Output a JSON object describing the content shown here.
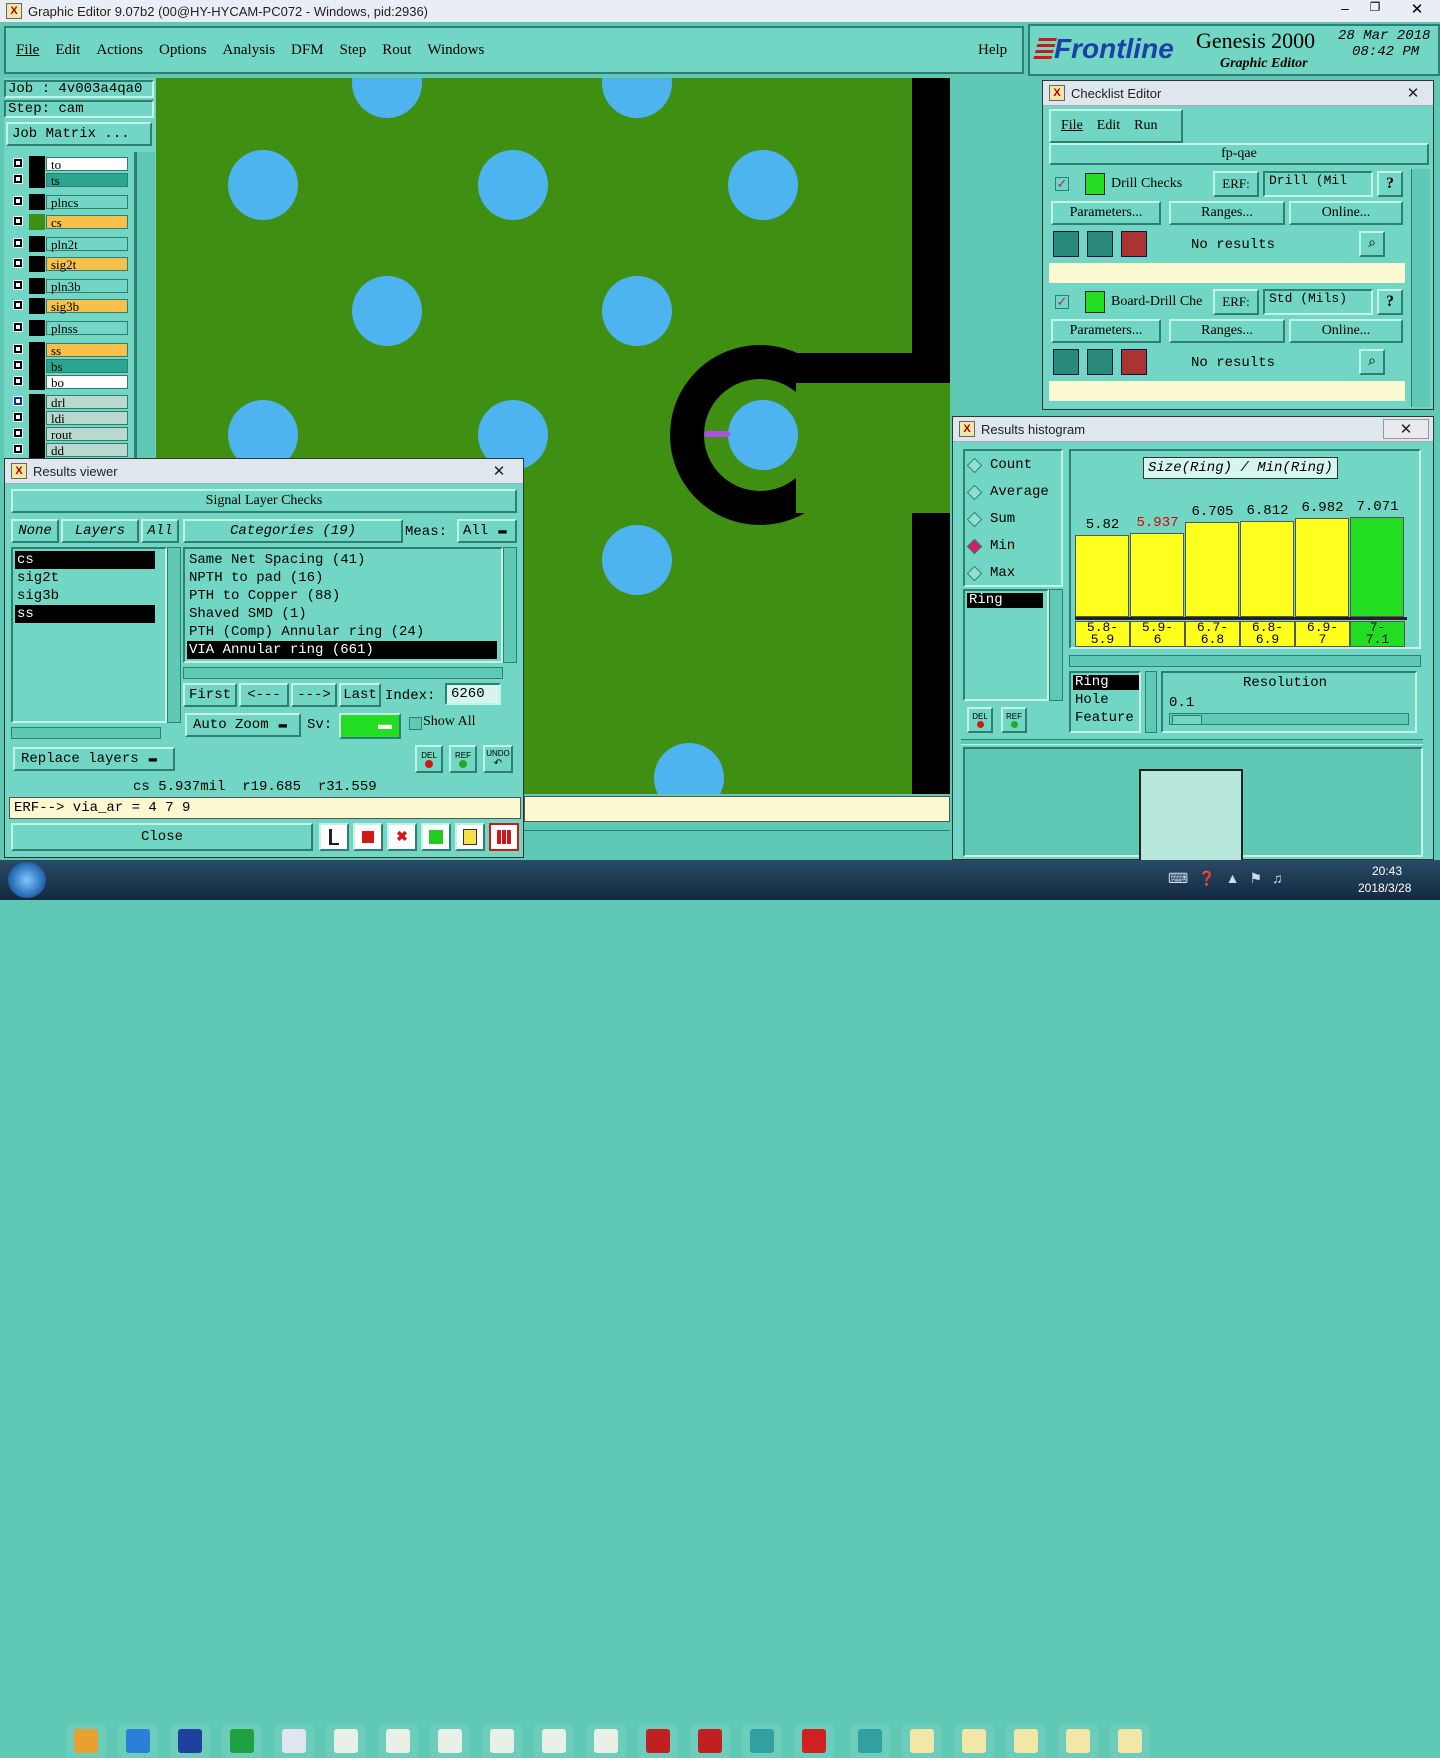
{
  "window": {
    "title": "Graphic Editor 9.07b2 (00@HY-HYCAM-PC072 - Windows, pid:2936)"
  },
  "menu": [
    "File",
    "Edit",
    "Actions",
    "Options",
    "Analysis",
    "DFM",
    "Step",
    "Rout",
    "Windows"
  ],
  "help_label": "Help",
  "brand": {
    "logo": "Frontline",
    "product": "Genesis 2000",
    "subtitle": "Graphic Editor",
    "date": "28 Mar 2018",
    "time": "08:42 PM"
  },
  "job": {
    "job_label": "Job : 4v003a4qa0",
    "step_label": "Step: cam",
    "matrix_button": "Job Matrix ..."
  },
  "layers": [
    {
      "name": "to",
      "color": "#ffffff"
    },
    {
      "name": "ts",
      "color": "#2aa58f"
    },
    {
      "name": "plncs",
      "color": "#71d6c3"
    },
    {
      "name": "cs",
      "color": "#f7c04a"
    },
    {
      "name": "pln2t",
      "color": "#71d6c3"
    },
    {
      "name": "sig2t",
      "color": "#f7c04a"
    },
    {
      "name": "pln3b",
      "color": "#71d6c3"
    },
    {
      "name": "sig3b",
      "color": "#f7c04a"
    },
    {
      "name": "plnss",
      "color": "#71d6c3"
    },
    {
      "name": "ss",
      "color": "#f7c04a"
    },
    {
      "name": "bs",
      "color": "#2aa58f"
    },
    {
      "name": "bo",
      "color": "#ffffff"
    },
    {
      "name": "drl",
      "color": "#b8d8d0"
    },
    {
      "name": "ldi",
      "color": "#b8d8d0"
    },
    {
      "name": "rout",
      "color": "#b8d8d0"
    },
    {
      "name": "dd",
      "color": "#b8d8d0"
    }
  ],
  "results_viewer": {
    "title": "Results viewer",
    "header": "Signal Layer Checks",
    "none_btn": "None",
    "layers_btn": "Layers",
    "all_btn": "All",
    "categories_btn": "Categories (19)",
    "meas_label": "Meas:",
    "meas_value": "All",
    "layer_list": [
      "cs",
      "sig2t",
      "sig3b",
      "ss"
    ],
    "categories": [
      "Same Net Spacing (41)",
      "NPTH to pad (16)",
      "PTH to Copper (88)",
      "Shaved SMD (1)",
      "PTH (Comp) Annular ring (24)",
      "VIA Annular ring (661)"
    ],
    "first": "First",
    "prev": "<---",
    "next": "--->",
    "last": "Last",
    "index_label": "Index:",
    "index_value": "6260",
    "auto_zoom": "Auto Zoom",
    "sv_label": "Sv:",
    "show_all": "Show All",
    "replace_layers": "Replace layers",
    "status": "cs 5.937mil  r19.685  r31.559",
    "erf": "ERF--> via_ar = 4 7 9",
    "close": "Close",
    "del": "DEL",
    "ref": "REF",
    "undo": "UNDO"
  },
  "checklist": {
    "title": "Checklist Editor",
    "menu": [
      "File",
      "Edit",
      "Run"
    ],
    "name": "fp-qae",
    "checks": [
      {
        "name": "Drill Checks",
        "erf_label": "ERF:",
        "erf_value": "Drill (Mil",
        "params": "Parameters...",
        "ranges": "Ranges...",
        "online": "Online...",
        "result": "No results"
      },
      {
        "name": "Board-Drill Che",
        "erf_label": "ERF:",
        "erf_value": "Std (Mils)",
        "params": "Parameters...",
        "ranges": "Ranges...",
        "online": "Online...",
        "result": "No results"
      }
    ],
    "help_glyph": "?"
  },
  "histogram": {
    "title": "Results histogram",
    "modes": [
      "Count",
      "Average",
      "Sum",
      "Min",
      "Max"
    ],
    "selected_mode": "Min",
    "heading": "Size(Ring) / Min(Ring)",
    "bins": [
      {
        "value": "5.82",
        "range": [
          "5.8-",
          "5.9"
        ],
        "level": 0.82,
        "color": "#ffff1e",
        "value_color": "#000000"
      },
      {
        "value": "5.937",
        "range": [
          "5.9-",
          "6"
        ],
        "level": 0.84,
        "color": "#ffff1e",
        "value_color": "#e00000"
      },
      {
        "value": "6.705",
        "range": [
          "6.7-",
          "6.8"
        ],
        "level": 0.95,
        "color": "#ffff1e",
        "value_color": "#000000"
      },
      {
        "value": "6.812",
        "range": [
          "6.8-",
          "6.9"
        ],
        "level": 0.96,
        "color": "#ffff1e",
        "value_color": "#000000"
      },
      {
        "value": "6.982",
        "range": [
          "6.9-",
          "7"
        ],
        "level": 0.99,
        "color": "#ffff1e",
        "value_color": "#000000"
      },
      {
        "value": "7.071",
        "range": [
          "7-",
          "7.1"
        ],
        "level": 1.0,
        "color": "#22dd22",
        "value_color": "#000000"
      }
    ],
    "attr_list": [
      "Ring"
    ],
    "attr_selected": "Ring",
    "field_list": [
      "Ring",
      "Hole",
      "Feature"
    ],
    "resolution_label": "Resolution",
    "resolution_value": "0.1",
    "del": "DEL",
    "ref": "REF"
  },
  "taskbar": {
    "time": "20:43",
    "date": "2018/3/28"
  },
  "colors": {
    "board": "#3f8f12",
    "pad": "#4db4f0",
    "panel": "#71d6c3",
    "highlight": "#b050e0"
  }
}
